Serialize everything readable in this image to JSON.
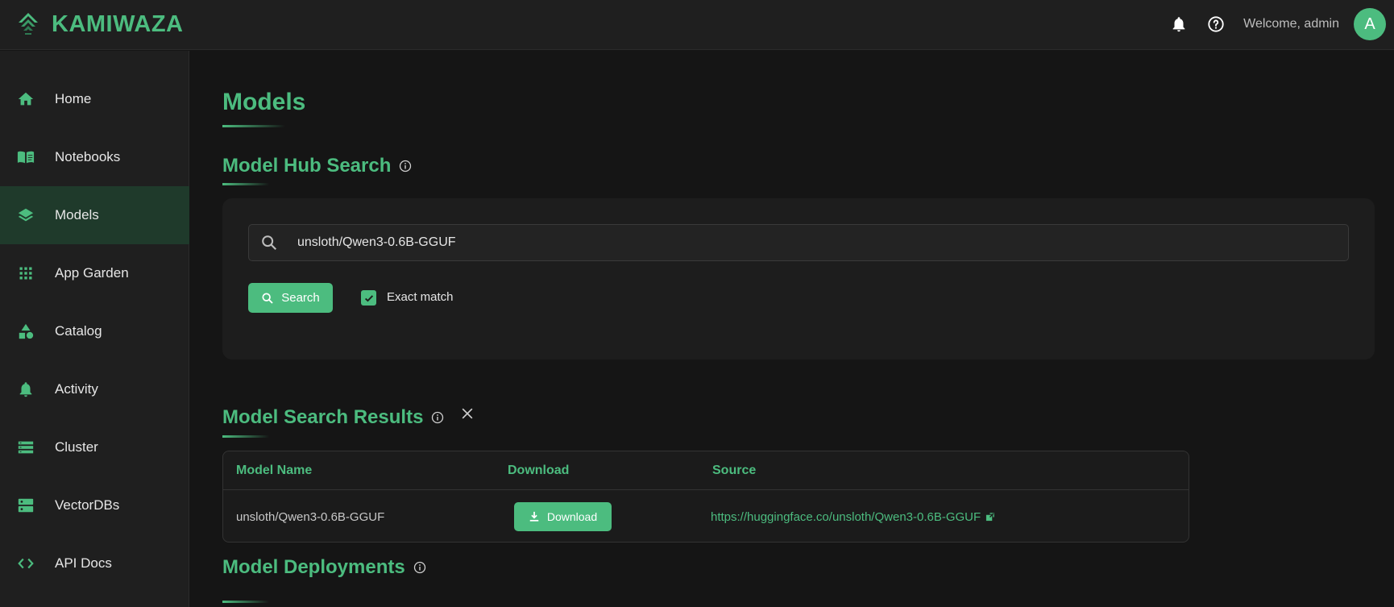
{
  "app": {
    "name": "KAMIWAZA",
    "welcome": "Welcome, admin",
    "avatar_letter": "A",
    "accent": "#4cbc7f"
  },
  "sidebar": {
    "items": [
      {
        "label": "Home",
        "icon": "home-icon"
      },
      {
        "label": "Notebooks",
        "icon": "book-icon"
      },
      {
        "label": "Models",
        "icon": "layers-icon",
        "active": true
      },
      {
        "label": "App Garden",
        "icon": "grid-icon"
      },
      {
        "label": "Catalog",
        "icon": "shapes-icon"
      },
      {
        "label": "Activity",
        "icon": "bell-icon"
      },
      {
        "label": "Cluster",
        "icon": "storage-icon"
      },
      {
        "label": "VectorDBs",
        "icon": "dns-icon"
      },
      {
        "label": "API Docs",
        "icon": "code-icon"
      }
    ]
  },
  "page": {
    "title": "Models"
  },
  "hub_search": {
    "title": "Model Hub Search",
    "query": "unsloth/Qwen3-0.6B-GGUF",
    "search_label": "Search",
    "exact_match_label": "Exact match",
    "exact_match_checked": true
  },
  "results": {
    "title": "Model Search Results",
    "columns": [
      "Model Name",
      "Download",
      "Source"
    ],
    "rows": [
      {
        "model_name": "unsloth/Qwen3-0.6B-GGUF",
        "download_label": "Download",
        "source": "https://huggingface.co/unsloth/Qwen3-0.6B-GGUF"
      }
    ]
  },
  "deployments": {
    "title": "Model Deployments"
  }
}
